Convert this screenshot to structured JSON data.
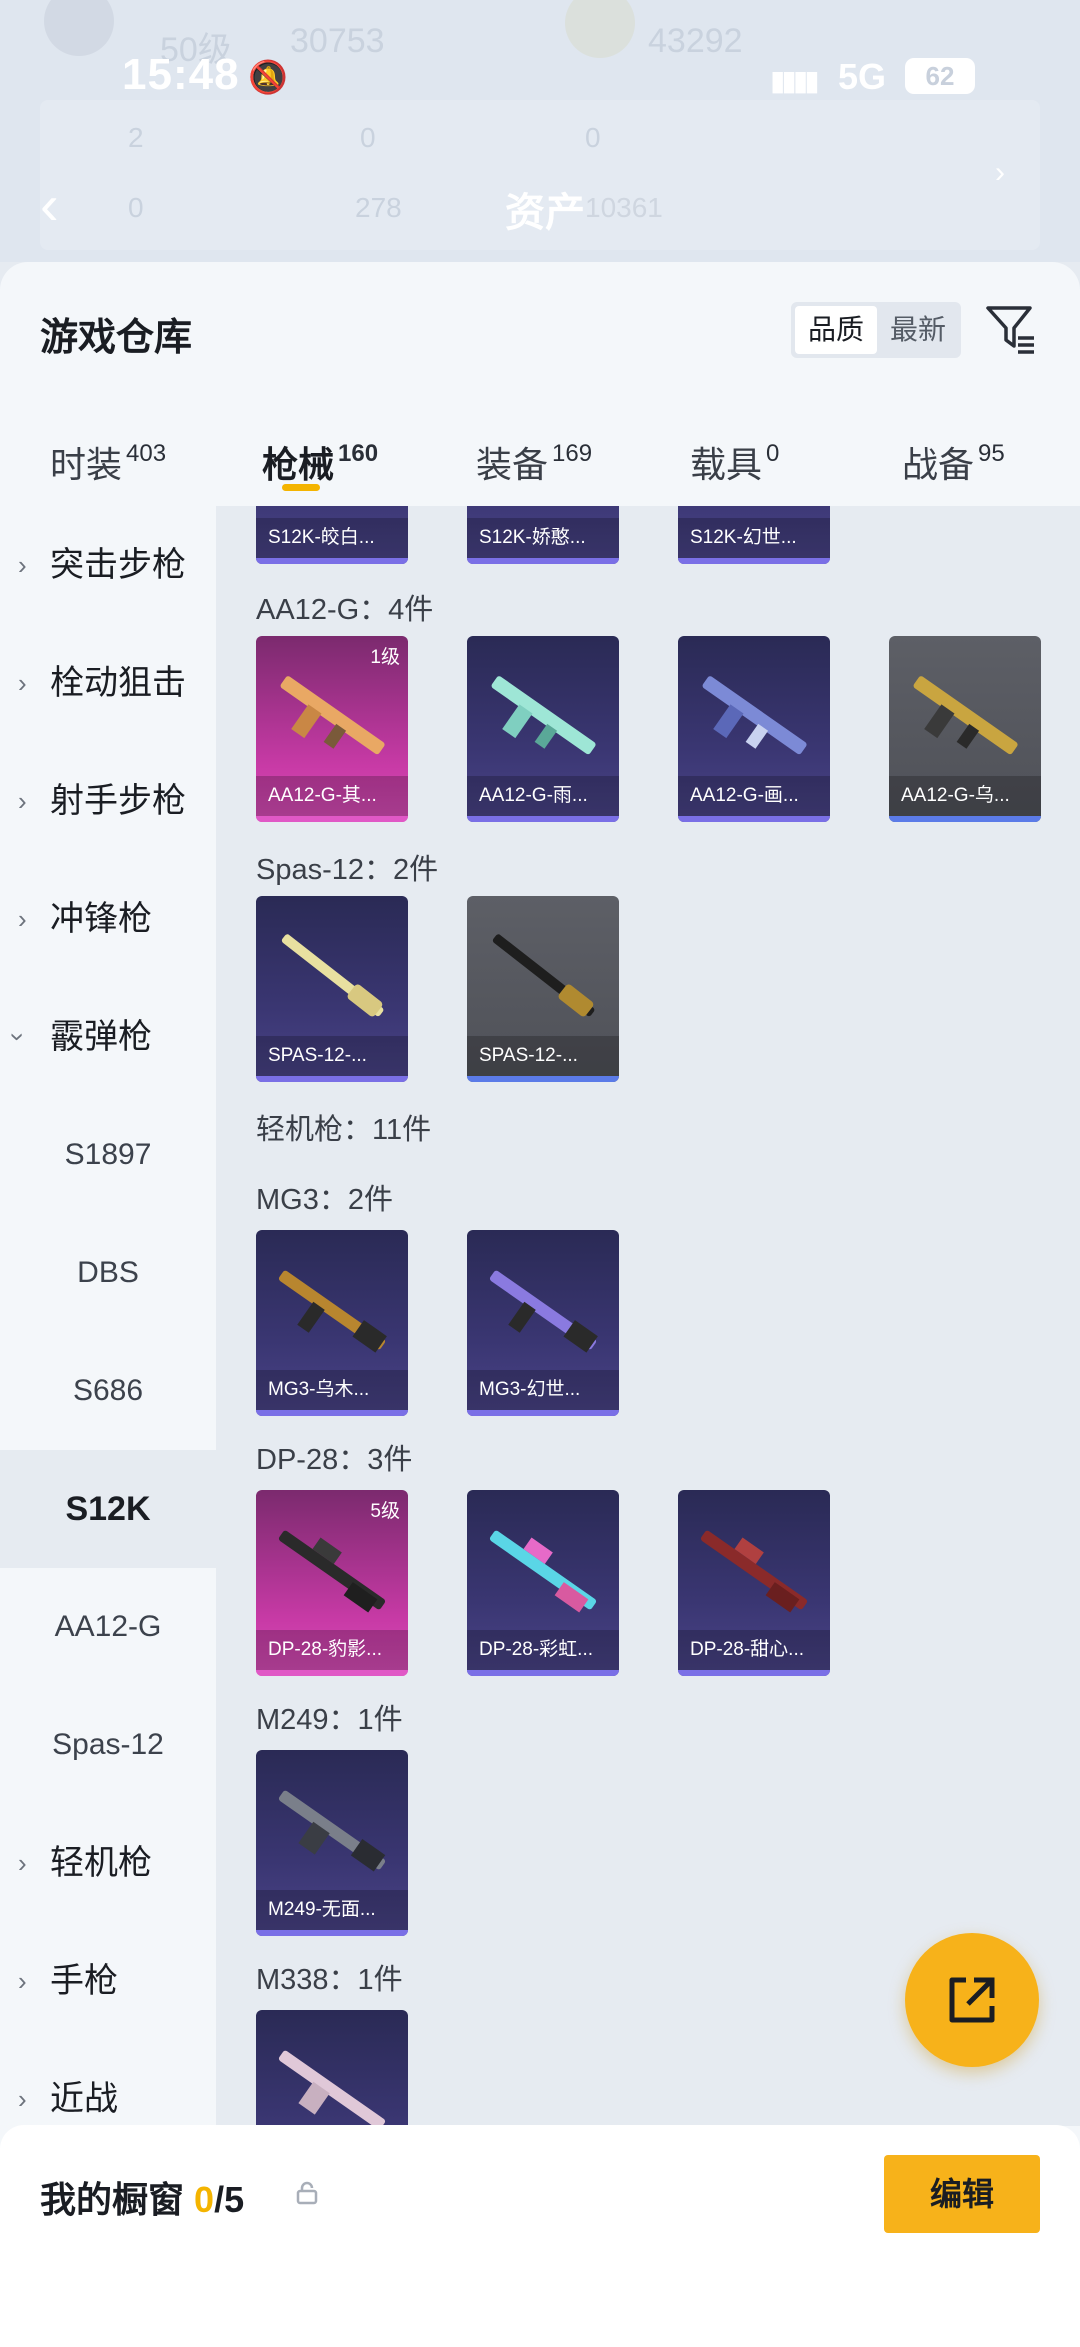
{
  "status_bar": {
    "time": "15:48",
    "network": "5G",
    "battery": "62"
  },
  "header": {
    "faded_level": "50级",
    "faded_coin": "30753",
    "faded_value_right": "43292",
    "faded_stats": [
      "2",
      "0",
      "0",
      "0",
      "278"
    ],
    "asset_title": "资产",
    "asset_value": "10361"
  },
  "panel": {
    "title": "游戏仓库",
    "sort_options": [
      "品质",
      "最新"
    ]
  },
  "tabs": [
    {
      "label": "时装",
      "count": "403"
    },
    {
      "label": "枪械",
      "count": "160"
    },
    {
      "label": "装备",
      "count": "169"
    },
    {
      "label": "载具",
      "count": "0"
    },
    {
      "label": "战备",
      "count": "95"
    }
  ],
  "sidebar": {
    "categories": [
      {
        "label": "突击步枪"
      },
      {
        "label": "栓动狙击"
      },
      {
        "label": "射手步枪"
      },
      {
        "label": "冲锋枪"
      },
      {
        "label": "霰弹枪"
      }
    ],
    "subitems": [
      "S1897",
      "DBS",
      "S686",
      "S12K",
      "AA12-G",
      "Spas-12"
    ],
    "categories_after": [
      {
        "label": "轻机枪"
      },
      {
        "label": "手枪"
      },
      {
        "label": "近战"
      }
    ]
  },
  "content": {
    "top_partial_cards": [
      "S12K-皎白...",
      "S12K-娇憨...",
      "S12K-幻世..."
    ],
    "sections": [
      {
        "title": "AA12-G：4件",
        "cards": [
          {
            "name": "AA12-G-其...",
            "level": "1级"
          },
          {
            "name": "AA12-G-雨..."
          },
          {
            "name": "AA12-G-画..."
          },
          {
            "name": "AA12-G-乌..."
          }
        ]
      },
      {
        "title": "Spas-12：2件",
        "cards": [
          {
            "name": "SPAS-12-..."
          },
          {
            "name": "SPAS-12-..."
          }
        ]
      },
      {
        "title": "轻机枪：11件"
      },
      {
        "title": "MG3：2件",
        "cards": [
          {
            "name": "MG3-乌木..."
          },
          {
            "name": "MG3-幻世..."
          }
        ]
      },
      {
        "title": "DP-28：3件",
        "cards": [
          {
            "name": "DP-28-豹影...",
            "level": "5级"
          },
          {
            "name": "DP-28-彩虹..."
          },
          {
            "name": "DP-28-甜心..."
          }
        ]
      },
      {
        "title": "M249：1件",
        "cards": [
          {
            "name": "M249-无面..."
          }
        ]
      },
      {
        "title": "M338：1件"
      }
    ]
  },
  "bottom_bar": {
    "label": "我的橱窗",
    "current": "0",
    "total": "/5",
    "edit_label": "编辑"
  },
  "colors": {
    "accent": "#f7b21a",
    "epic": "#d84fb8",
    "rare": "#7a6fe6"
  }
}
